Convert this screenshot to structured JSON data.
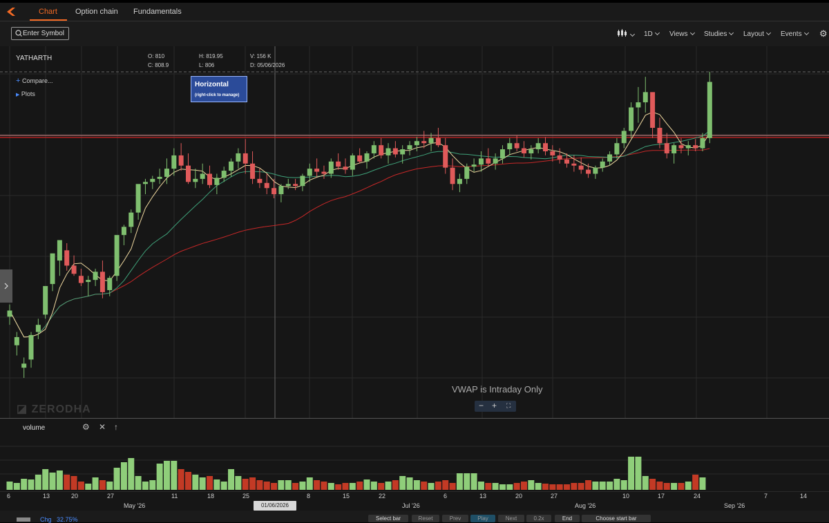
{
  "tabs": [
    {
      "label": "Chart",
      "active": true
    },
    {
      "label": "Option chain",
      "active": false
    },
    {
      "label": "Fundamentals",
      "active": false
    }
  ],
  "search": {
    "placeholder": "Enter Symbol"
  },
  "toolbar": {
    "interval": "1D",
    "views": "Views",
    "studies": "Studies",
    "layout": "Layout",
    "events": "Events"
  },
  "chart": {
    "symbol": "YATHARTH",
    "ohlc": {
      "o_label": "O:",
      "o": "810",
      "h_label": "H:",
      "h": "819.95",
      "v_label": "V:",
      "v": "156 K",
      "c_label": "C:",
      "c": "808.9",
      "l_label": "L:",
      "l": "806",
      "d_label": "D:",
      "d": "05/06/2026"
    },
    "compare": "Compare...",
    "plots": "Plots",
    "tooltip_title": "Horizontal",
    "tooltip_sub": "(right-click to manage)",
    "vwap_msg": "VWAP is Intraday Only",
    "watermark": "ZERODHA",
    "crosshair_date": "01/06/2026"
  },
  "volume_panel": {
    "label": "volume"
  },
  "x_axis": {
    "ticks": [
      "6",
      "13",
      "20",
      "27",
      "11",
      "18",
      "25",
      "8",
      "15",
      "22",
      "6",
      "13",
      "20",
      "27",
      "10",
      "17",
      "24",
      "7",
      "14"
    ],
    "months": [
      "May '26",
      "Jul '26",
      "Aug '26",
      "Sep '26"
    ]
  },
  "bottom": {
    "chg_label": "Chg",
    "chg_value": "32.75%",
    "buttons": [
      "Select bar",
      "Reset",
      "Prev",
      "Play",
      "Next",
      "0.2x",
      "End",
      "Choose start bar"
    ]
  },
  "colors": {
    "up": "#7fbf6f",
    "down": "#e05a5a",
    "accent": "#f46a24",
    "vol_up": "#8fce7a",
    "vol_down": "#c33a25"
  },
  "chart_data": {
    "type": "candlestick",
    "series": [
      {
        "o": 750,
        "h": 762,
        "l": 742,
        "c": 756
      },
      {
        "o": 722,
        "h": 735,
        "l": 712,
        "c": 730
      },
      {
        "o": 700,
        "h": 710,
        "l": 690,
        "c": 704
      },
      {
        "o": 708,
        "h": 735,
        "l": 700,
        "c": 732
      },
      {
        "o": 735,
        "h": 748,
        "l": 728,
        "c": 742
      },
      {
        "o": 752,
        "h": 770,
        "l": 748,
        "c": 780
      },
      {
        "o": 782,
        "h": 790,
        "l": 775,
        "c": 812
      },
      {
        "o": 805,
        "h": 820,
        "l": 790,
        "c": 825
      },
      {
        "o": 815,
        "h": 822,
        "l": 795,
        "c": 800
      },
      {
        "o": 800,
        "h": 810,
        "l": 790,
        "c": 792
      },
      {
        "o": 790,
        "h": 797,
        "l": 780,
        "c": 783
      },
      {
        "o": 784,
        "h": 790,
        "l": 770,
        "c": 786
      },
      {
        "o": 786,
        "h": 797,
        "l": 780,
        "c": 794
      },
      {
        "o": 794,
        "h": 805,
        "l": 768,
        "c": 774
      },
      {
        "o": 776,
        "h": 790,
        "l": 770,
        "c": 788
      },
      {
        "o": 790,
        "h": 810,
        "l": 785,
        "c": 830
      },
      {
        "o": 830,
        "h": 840,
        "l": 820,
        "c": 838
      },
      {
        "o": 838,
        "h": 855,
        "l": 832,
        "c": 852
      },
      {
        "o": 852,
        "h": 870,
        "l": 845,
        "c": 880
      },
      {
        "o": 880,
        "h": 885,
        "l": 870,
        "c": 882
      },
      {
        "o": 882,
        "h": 888,
        "l": 875,
        "c": 885
      },
      {
        "o": 885,
        "h": 895,
        "l": 880,
        "c": 887
      },
      {
        "o": 887,
        "h": 905,
        "l": 880,
        "c": 895
      },
      {
        "o": 895,
        "h": 915,
        "l": 888,
        "c": 908
      },
      {
        "o": 908,
        "h": 920,
        "l": 893,
        "c": 898
      },
      {
        "o": 898,
        "h": 910,
        "l": 880,
        "c": 882
      },
      {
        "o": 882,
        "h": 895,
        "l": 876,
        "c": 885
      },
      {
        "o": 885,
        "h": 900,
        "l": 880,
        "c": 890
      },
      {
        "o": 890,
        "h": 898,
        "l": 876,
        "c": 879
      },
      {
        "o": 879,
        "h": 890,
        "l": 870,
        "c": 886
      },
      {
        "o": 886,
        "h": 897,
        "l": 882,
        "c": 893
      },
      {
        "o": 893,
        "h": 905,
        "l": 887,
        "c": 902
      },
      {
        "o": 902,
        "h": 915,
        "l": 895,
        "c": 910
      },
      {
        "o": 910,
        "h": 924,
        "l": 890,
        "c": 900
      },
      {
        "o": 900,
        "h": 912,
        "l": 880,
        "c": 885
      },
      {
        "o": 885,
        "h": 895,
        "l": 876,
        "c": 881
      },
      {
        "o": 881,
        "h": 890,
        "l": 870,
        "c": 876
      },
      {
        "o": 876,
        "h": 885,
        "l": 866,
        "c": 870
      },
      {
        "o": 870,
        "h": 880,
        "l": 862,
        "c": 878
      },
      {
        "o": 878,
        "h": 885,
        "l": 875,
        "c": 880
      },
      {
        "o": 880,
        "h": 885,
        "l": 874,
        "c": 878
      },
      {
        "o": 878,
        "h": 890,
        "l": 873,
        "c": 888
      },
      {
        "o": 888,
        "h": 900,
        "l": 882,
        "c": 895
      },
      {
        "o": 895,
        "h": 905,
        "l": 887,
        "c": 892
      },
      {
        "o": 892,
        "h": 898,
        "l": 885,
        "c": 890
      },
      {
        "o": 890,
        "h": 905,
        "l": 886,
        "c": 902
      },
      {
        "o": 902,
        "h": 910,
        "l": 894,
        "c": 897
      },
      {
        "o": 897,
        "h": 905,
        "l": 890,
        "c": 894
      },
      {
        "o": 894,
        "h": 910,
        "l": 888,
        "c": 908
      },
      {
        "o": 908,
        "h": 915,
        "l": 900,
        "c": 902
      },
      {
        "o": 902,
        "h": 912,
        "l": 895,
        "c": 910
      },
      {
        "o": 910,
        "h": 922,
        "l": 905,
        "c": 918
      },
      {
        "o": 918,
        "h": 925,
        "l": 905,
        "c": 908
      },
      {
        "o": 908,
        "h": 920,
        "l": 900,
        "c": 915
      },
      {
        "o": 915,
        "h": 922,
        "l": 906,
        "c": 909
      },
      {
        "o": 909,
        "h": 918,
        "l": 900,
        "c": 914
      },
      {
        "o": 914,
        "h": 922,
        "l": 908,
        "c": 918
      },
      {
        "o": 918,
        "h": 926,
        "l": 912,
        "c": 922
      },
      {
        "o": 922,
        "h": 932,
        "l": 915,
        "c": 920
      },
      {
        "o": 920,
        "h": 930,
        "l": 912,
        "c": 925
      },
      {
        "o": 925,
        "h": 935,
        "l": 916,
        "c": 918
      },
      {
        "o": 918,
        "h": 925,
        "l": 890,
        "c": 896
      },
      {
        "o": 896,
        "h": 905,
        "l": 874,
        "c": 880
      },
      {
        "o": 880,
        "h": 890,
        "l": 872,
        "c": 885
      },
      {
        "o": 885,
        "h": 900,
        "l": 880,
        "c": 897
      },
      {
        "o": 897,
        "h": 905,
        "l": 892,
        "c": 899
      },
      {
        "o": 899,
        "h": 912,
        "l": 892,
        "c": 905
      },
      {
        "o": 905,
        "h": 915,
        "l": 898,
        "c": 900
      },
      {
        "o": 900,
        "h": 910,
        "l": 894,
        "c": 905
      },
      {
        "o": 905,
        "h": 918,
        "l": 900,
        "c": 914
      },
      {
        "o": 914,
        "h": 925,
        "l": 908,
        "c": 920
      },
      {
        "o": 920,
        "h": 928,
        "l": 912,
        "c": 915
      },
      {
        "o": 915,
        "h": 922,
        "l": 906,
        "c": 910
      },
      {
        "o": 910,
        "h": 918,
        "l": 904,
        "c": 914
      },
      {
        "o": 914,
        "h": 925,
        "l": 910,
        "c": 920
      },
      {
        "o": 920,
        "h": 926,
        "l": 908,
        "c": 912
      },
      {
        "o": 912,
        "h": 918,
        "l": 902,
        "c": 908
      },
      {
        "o": 908,
        "h": 915,
        "l": 900,
        "c": 904
      },
      {
        "o": 904,
        "h": 910,
        "l": 896,
        "c": 900
      },
      {
        "o": 900,
        "h": 908,
        "l": 892,
        "c": 898
      },
      {
        "o": 898,
        "h": 906,
        "l": 890,
        "c": 894
      },
      {
        "o": 894,
        "h": 900,
        "l": 886,
        "c": 890
      },
      {
        "o": 890,
        "h": 898,
        "l": 885,
        "c": 896
      },
      {
        "o": 896,
        "h": 905,
        "l": 892,
        "c": 902
      },
      {
        "o": 902,
        "h": 912,
        "l": 898,
        "c": 909
      },
      {
        "o": 909,
        "h": 925,
        "l": 905,
        "c": 920
      },
      {
        "o": 920,
        "h": 935,
        "l": 915,
        "c": 932
      },
      {
        "o": 932,
        "h": 960,
        "l": 925,
        "c": 955
      },
      {
        "o": 955,
        "h": 975,
        "l": 940,
        "c": 960
      },
      {
        "o": 960,
        "h": 985,
        "l": 950,
        "c": 970
      },
      {
        "o": 970,
        "h": 968,
        "l": 925,
        "c": 935
      },
      {
        "o": 935,
        "h": 945,
        "l": 915,
        "c": 920
      },
      {
        "o": 920,
        "h": 930,
        "l": 905,
        "c": 910
      },
      {
        "o": 910,
        "h": 920,
        "l": 900,
        "c": 918
      },
      {
        "o": 918,
        "h": 925,
        "l": 910,
        "c": 915
      },
      {
        "o": 915,
        "h": 922,
        "l": 908,
        "c": 918
      },
      {
        "o": 918,
        "h": 924,
        "l": 912,
        "c": 915
      },
      {
        "o": 915,
        "h": 930,
        "l": 912,
        "c": 925
      },
      {
        "o": 925,
        "h": 990,
        "l": 920,
        "c": 980
      }
    ],
    "volume_top": [
      12,
      10,
      16,
      15,
      22,
      30,
      25,
      28,
      22,
      20,
      12,
      9,
      18,
      14,
      12,
      32,
      40,
      46,
      20,
      12,
      14,
      38,
      42,
      42,
      30,
      26,
      22,
      18,
      20,
      15,
      12,
      30,
      20,
      16,
      18,
      14,
      12,
      10,
      14,
      14,
      10,
      12,
      18,
      14,
      12,
      10,
      8,
      10,
      10,
      12,
      15,
      12,
      10,
      12,
      14,
      20,
      18,
      14,
      12,
      10,
      12,
      14,
      10,
      24,
      24,
      24,
      12,
      10,
      10,
      8,
      8,
      10,
      12,
      14,
      10,
      9,
      8,
      8,
      8,
      10,
      10,
      14,
      12,
      12,
      12,
      16,
      14,
      48,
      48,
      20,
      16,
      12,
      10,
      10,
      10,
      12,
      22,
      18
    ]
  }
}
